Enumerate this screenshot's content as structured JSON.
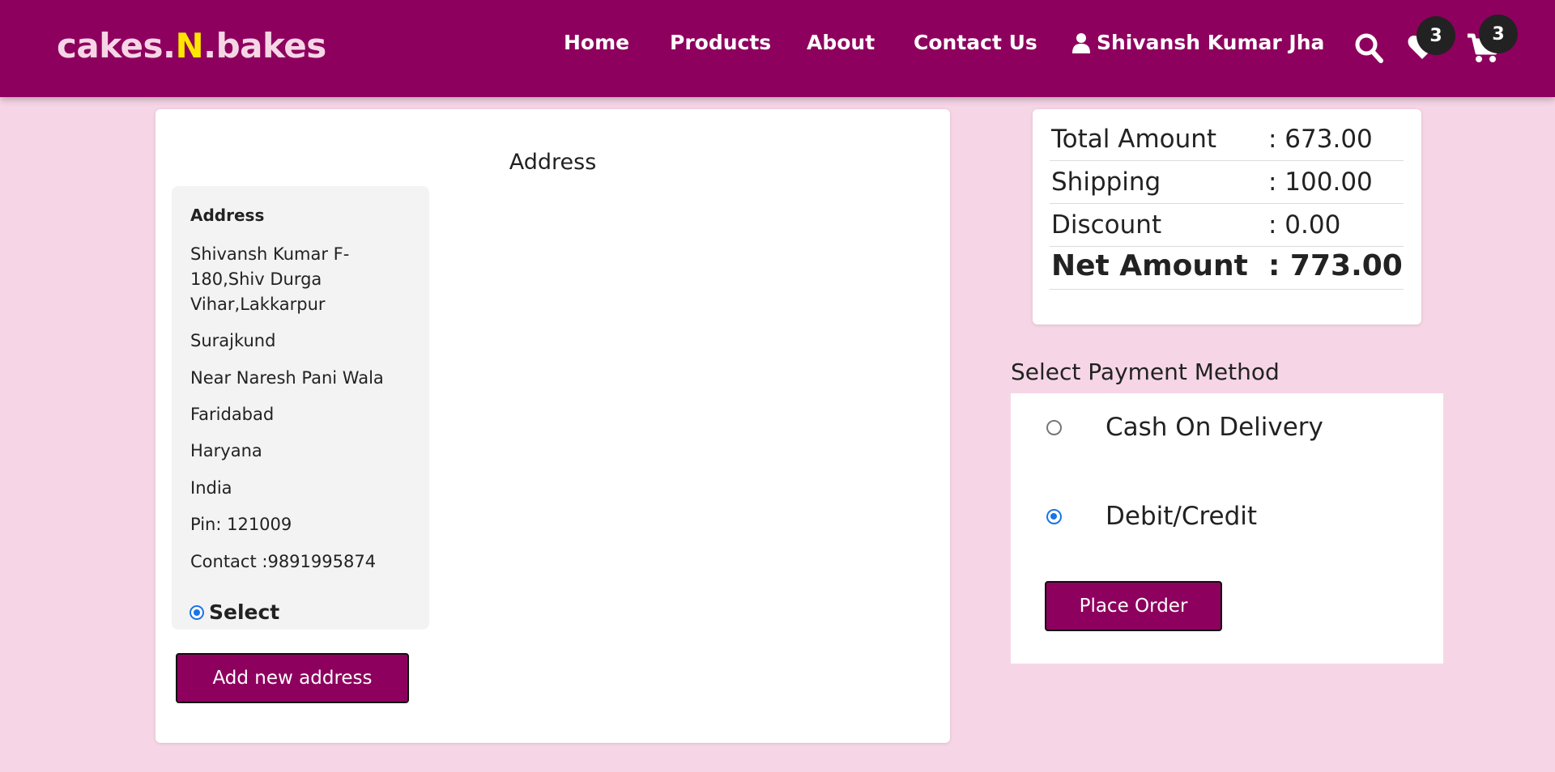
{
  "brand": {
    "part1": "cakes.",
    "accent": "N",
    "part2": ".bakes"
  },
  "nav": {
    "home": "Home",
    "products": "Products",
    "about": "About",
    "contact": "Contact Us",
    "user": "Shivansh Kumar Jha",
    "wishlist_count": "3",
    "cart_count": "3"
  },
  "address_section": {
    "heading": "Address",
    "card": {
      "title": "Address",
      "lines": [
        "Shivansh Kumar F-180,Shiv Durga Vihar,Lakkarpur",
        "Surajkund",
        "Near Naresh Pani Wala",
        "Faridabad",
        "Haryana",
        "India",
        "Pin: 121009",
        "Contact :9891995874"
      ],
      "select_label": "Select",
      "selected": true
    },
    "add_button": "Add new address"
  },
  "summary": {
    "rows": [
      {
        "label": "Total Amount",
        "value": ": 673.00"
      },
      {
        "label": "Shipping",
        "value": ": 100.00"
      },
      {
        "label": "Discount",
        "value": ": 0.00"
      },
      {
        "label": "Net Amount",
        "value": ": 773.00"
      }
    ]
  },
  "payment": {
    "heading": "Select Payment Method",
    "options": [
      {
        "label": "Cash On Delivery",
        "selected": false
      },
      {
        "label": "Debit/Credit",
        "selected": true
      }
    ],
    "place_order": "Place Order"
  },
  "colors": {
    "brand": "#8e005e",
    "background": "#f6d6e6",
    "accent": "#ffe600"
  }
}
